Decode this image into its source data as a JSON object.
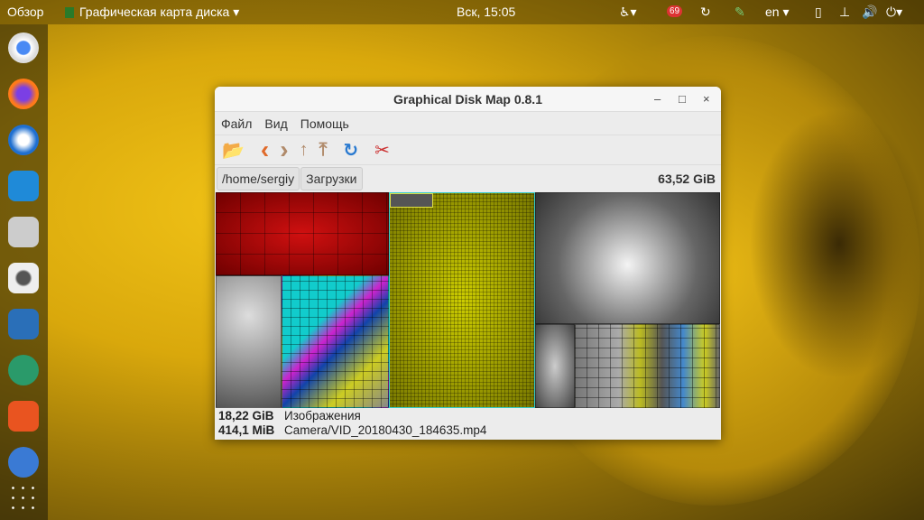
{
  "topbar": {
    "overview": "Обзор",
    "app_menu": "Графическая карта диска ▾",
    "clock": "Вск, 15:05",
    "notif_count": "69",
    "lang": "en ▾"
  },
  "window": {
    "title": "Graphical Disk Map 0.8.1",
    "minimize": "–",
    "maximize": "□",
    "close": "×"
  },
  "menu": [
    "Файл",
    "Вид",
    "Помощь"
  ],
  "toolbar": [
    {
      "icon": "open-folder-icon",
      "glyph": "📂"
    },
    {
      "icon": "back-icon",
      "glyph": "‹"
    },
    {
      "icon": "forward-icon",
      "glyph": "›"
    },
    {
      "icon": "up-icon",
      "glyph": "↑"
    },
    {
      "icon": "top-icon",
      "glyph": "⤒"
    },
    {
      "icon": "refresh-icon",
      "glyph": "↻"
    },
    {
      "icon": "settings-icon",
      "glyph": "✂"
    }
  ],
  "path": {
    "segments": [
      "/home/sergiy",
      "Загрузки"
    ],
    "total": "63,52 GiB"
  },
  "status": {
    "dir_size": "18,22 GiB",
    "dir_name": "Изображения",
    "file_size": "414,1 MiB",
    "file_name": "Camera/VID_20180430_184635.mp4"
  },
  "colors": {
    "accent": "#e95420"
  }
}
